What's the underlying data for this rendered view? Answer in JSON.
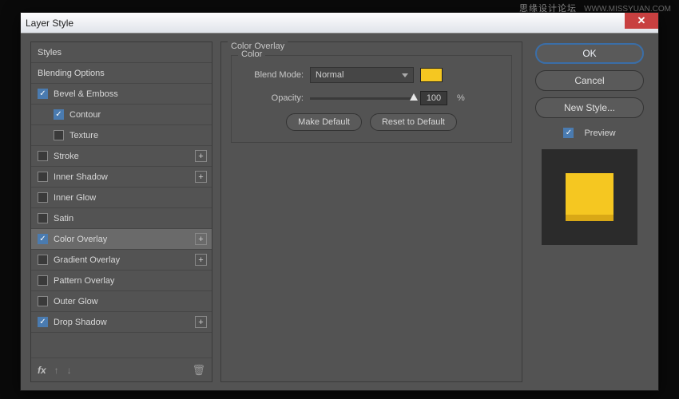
{
  "watermark": {
    "cn": "思缘设计论坛",
    "url": "WWW.MISSYUAN.COM"
  },
  "titlebar": {
    "title": "Layer Style"
  },
  "styles_list": {
    "header_styles": "Styles",
    "header_blending": "Blending Options",
    "bevel": "Bevel & Emboss",
    "contour": "Contour",
    "texture": "Texture",
    "stroke": "Stroke",
    "inner_shadow": "Inner Shadow",
    "inner_glow": "Inner Glow",
    "satin": "Satin",
    "color_overlay": "Color Overlay",
    "gradient_overlay": "Gradient Overlay",
    "pattern_overlay": "Pattern Overlay",
    "outer_glow": "Outer Glow",
    "drop_shadow": "Drop Shadow"
  },
  "center": {
    "section_title": "Color Overlay",
    "group_title": "Color",
    "blend_mode_label": "Blend Mode:",
    "blend_mode_value": "Normal",
    "opacity_label": "Opacity:",
    "opacity_value": "100",
    "opacity_unit": "%",
    "overlay_color": "#f5c721",
    "make_default": "Make Default",
    "reset_default": "Reset to Default"
  },
  "right": {
    "ok": "OK",
    "cancel": "Cancel",
    "new_style": "New Style...",
    "preview": "Preview"
  },
  "footer": {
    "fx": "fx"
  }
}
